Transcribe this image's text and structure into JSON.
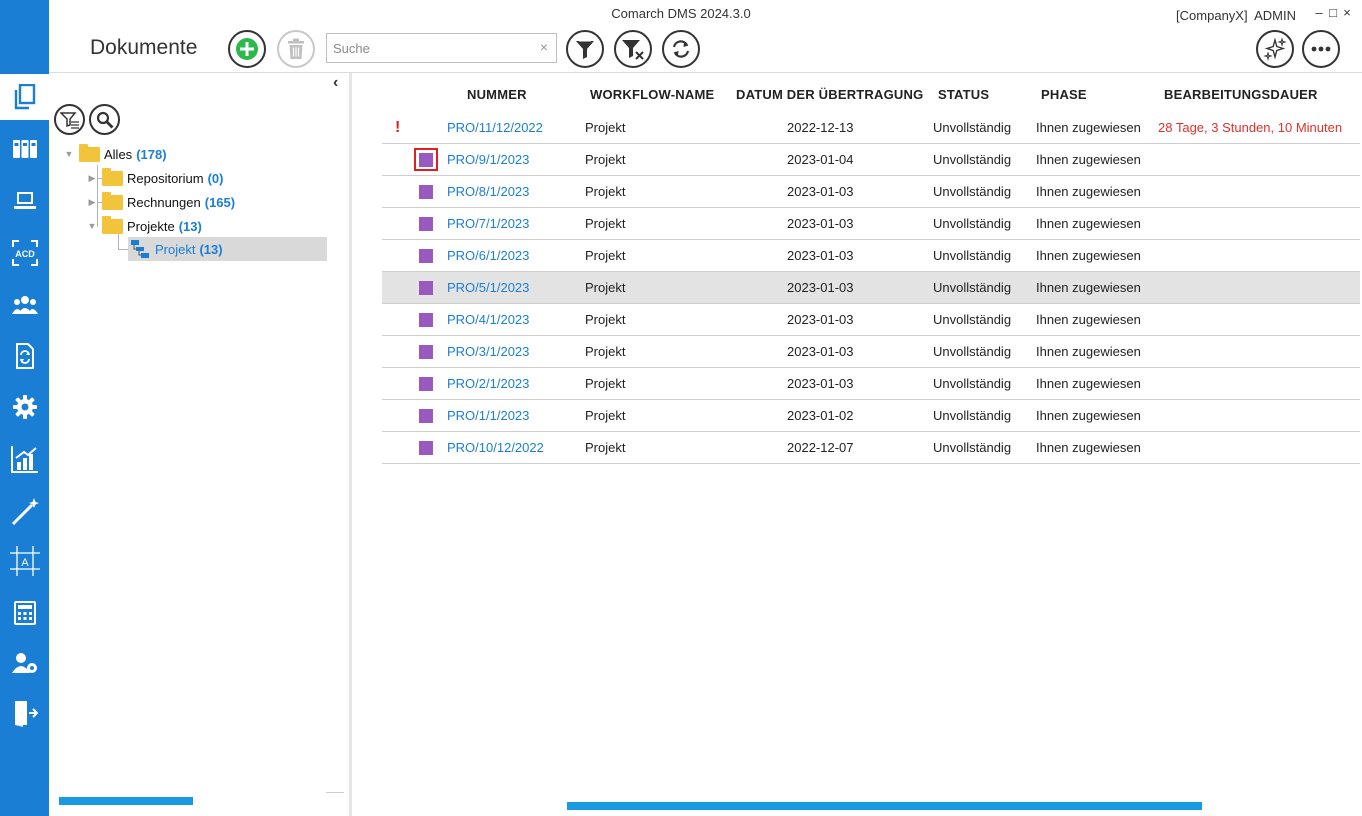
{
  "window": {
    "title": "Comarch DMS 2024.3.0",
    "company": "[CompanyX]",
    "user": "ADMIN",
    "controls": {
      "minimize": "–",
      "maximize": "□",
      "close": "×"
    }
  },
  "nav": {
    "items": [
      {
        "name": "documents-icon",
        "active": true
      },
      {
        "name": "repository-icon",
        "active": false
      },
      {
        "name": "workstation-icon",
        "active": false
      },
      {
        "name": "ocr-acd-icon",
        "active": false
      },
      {
        "name": "users-group-icon",
        "active": false
      },
      {
        "name": "document-sync-icon",
        "active": false
      },
      {
        "name": "settings-gear-icon",
        "active": false
      },
      {
        "name": "reports-chart-icon",
        "active": false
      },
      {
        "name": "magic-wand-icon",
        "active": false
      },
      {
        "name": "template-designer-icon",
        "active": false
      },
      {
        "name": "calculator-icon",
        "active": false
      },
      {
        "name": "user-settings-icon",
        "active": false
      },
      {
        "name": "logout-icon",
        "active": false
      }
    ]
  },
  "toolbar": {
    "page_title": "Dokumente",
    "search_placeholder": "Suche",
    "search_clear": "×"
  },
  "tree": {
    "collapse_arrow": "‹",
    "root": {
      "label": "Alles",
      "count": "(178)"
    },
    "children": [
      {
        "label": "Repositorium",
        "count": "(0)"
      },
      {
        "label": "Rechnungen",
        "count": "(165)"
      },
      {
        "label": "Projekte",
        "count": "(13)"
      }
    ],
    "selected": {
      "label": "Projekt",
      "count": "(13)"
    }
  },
  "grid": {
    "columns": [
      "NUMMER",
      "WORKFLOW-NAME",
      "DATUM DER ÜBERTRAGUNG",
      "STATUS",
      "PHASE",
      "BEARBEITUNGSDAUER"
    ],
    "rows": [
      {
        "flag": "!",
        "number": "PRO/11/12/2022",
        "workflow": "Projekt",
        "date": "2022-12-13",
        "status": "Unvollständig",
        "phase": "Ihnen zugewiesen",
        "duration": "28 Tage, 3 Stunden, 10 Minuten"
      },
      {
        "number": "PRO/9/1/2023",
        "workflow": "Projekt",
        "date": "2023-01-04",
        "status": "Unvollständig",
        "phase": "Ihnen zugewiesen",
        "duration": ""
      },
      {
        "number": "PRO/8/1/2023",
        "workflow": "Projekt",
        "date": "2023-01-03",
        "status": "Unvollständig",
        "phase": "Ihnen zugewiesen",
        "duration": ""
      },
      {
        "number": "PRO/7/1/2023",
        "workflow": "Projekt",
        "date": "2023-01-03",
        "status": "Unvollständig",
        "phase": "Ihnen zugewiesen",
        "duration": ""
      },
      {
        "number": "PRO/6/1/2023",
        "workflow": "Projekt",
        "date": "2023-01-03",
        "status": "Unvollständig",
        "phase": "Ihnen zugewiesen",
        "duration": ""
      },
      {
        "number": "PRO/5/1/2023",
        "workflow": "Projekt",
        "date": "2023-01-03",
        "status": "Unvollständig",
        "phase": "Ihnen zugewiesen",
        "duration": ""
      },
      {
        "number": "PRO/4/1/2023",
        "workflow": "Projekt",
        "date": "2023-01-03",
        "status": "Unvollständig",
        "phase": "Ihnen zugewiesen",
        "duration": ""
      },
      {
        "number": "PRO/3/1/2023",
        "workflow": "Projekt",
        "date": "2023-01-03",
        "status": "Unvollständig",
        "phase": "Ihnen zugewiesen",
        "duration": ""
      },
      {
        "number": "PRO/2/1/2023",
        "workflow": "Projekt",
        "date": "2023-01-03",
        "status": "Unvollständig",
        "phase": "Ihnen zugewiesen",
        "duration": ""
      },
      {
        "number": "PRO/1/1/2023",
        "workflow": "Projekt",
        "date": "2023-01-02",
        "status": "Unvollständig",
        "phase": "Ihnen zugewiesen",
        "duration": ""
      },
      {
        "number": "PRO/10/12/2022",
        "workflow": "Projekt",
        "date": "2022-12-07",
        "status": "Unvollständig",
        "phase": "Ihnen zugewiesen",
        "duration": ""
      }
    ]
  },
  "colors": {
    "accent": "#1a7fd4",
    "status_square": "#9b59c0",
    "warning": "#e0312b",
    "folder": "#f2c43c"
  }
}
